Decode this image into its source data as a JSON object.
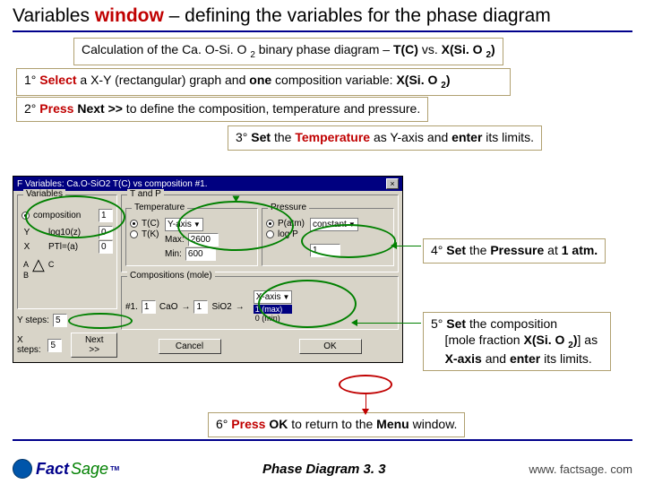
{
  "title": {
    "prefix": "Variables ",
    "highlight": "window",
    "suffix": " – defining the variables for the phase diagram"
  },
  "callouts": {
    "top": "Calculation of the Ca. O-Si. O 2 binary phase diagram – T(C) vs. X(Si. O 2)",
    "step1": "1° Select a X-Y (rectangular) graph and one composition variable: X(Si. O 2)",
    "step2": "2° Press Next >> to define the composition, temperature and pressure.",
    "step3": "3° Set the Temperature as Y-axis and enter its limits.",
    "step4": "4° Set the Pressure at 1 atm.",
    "step5a": "5° Set the composition",
    "step5b": "[mole fraction X(Si. O 2)] as",
    "step5c": "X-axis and enter its limits.",
    "step6": "6° Press OK to return to the Menu window."
  },
  "dialog": {
    "title": "F Variables: Ca.O-SiO2  T(C) vs composition #1.",
    "close": "×",
    "groups": {
      "variables": "Variables",
      "tp": "T and P",
      "temperature": "Temperature",
      "pressure": "Pressure",
      "compositions": "Compositions (mole)"
    },
    "vars": {
      "composition": "composition",
      "comp_val": "1",
      "log10z": "log10(z)",
      "log10z_val": "0",
      "ptla": "PTl=(a)",
      "ptla_val": "0",
      "triangle_a": "A",
      "triangle_b": "B",
      "triangle_c": "C",
      "ysteps_lbl": "Y steps:",
      "ysteps_val": "5",
      "xsteps_lbl": "X steps:",
      "xsteps_val": "5",
      "next": "Next >>"
    },
    "temp": {
      "tc": "T(C)",
      "tk": "T(K)",
      "yaxis": "Y-axis",
      "max_lbl": "Max:",
      "max_val": "2600",
      "min_lbl": "Min:",
      "min_val": "600"
    },
    "press": {
      "patm": "P(atm)",
      "logp": "log P",
      "constant": "constant",
      "val": "1"
    },
    "comp": {
      "row_no": "#1.",
      "cao": "CaO",
      "cao_val": "1",
      "sio2": "SiO2",
      "sio2_val": "1",
      "xaxis": "X-axis",
      "max_lbl": "1 (max)",
      "min_lbl": "0 (min)"
    },
    "buttons": {
      "cancel": "Cancel",
      "ok": "OK"
    }
  },
  "footer": {
    "logo_fact": "Fact",
    "logo_sage": "Sage",
    "tm": "TM",
    "center": "Phase Diagram  3. 3",
    "right": "www. factsage. com"
  }
}
